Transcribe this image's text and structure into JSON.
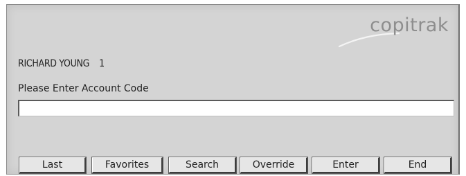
{
  "logo": {
    "text": "copitrak"
  },
  "session": {
    "user_name": "RICHARD YOUNG",
    "user_number": "1"
  },
  "prompt": {
    "text": "Please Enter Account Code"
  },
  "account_code": {
    "value": ""
  },
  "buttons": {
    "last": "Last",
    "favorites": "Favorites",
    "search": "Search",
    "override": "Override",
    "enter": "Enter",
    "end": "End"
  }
}
